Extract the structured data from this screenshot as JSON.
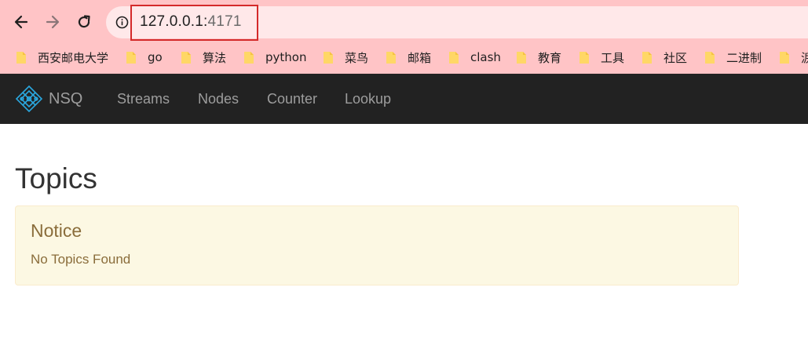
{
  "browser": {
    "address": {
      "host": "127.0.0.1:",
      "port": "4171"
    },
    "bookmarks": [
      {
        "label": "西安邮电大学",
        "icon": "folder-icon"
      },
      {
        "label": "go",
        "icon": "folder-icon"
      },
      {
        "label": "算法",
        "icon": "folder-icon"
      },
      {
        "label": "python",
        "icon": "folder-icon"
      },
      {
        "label": "菜鸟",
        "icon": "folder-icon"
      },
      {
        "label": "邮箱",
        "icon": "folder-icon"
      },
      {
        "label": "clash",
        "icon": "folder-icon"
      },
      {
        "label": "教育",
        "icon": "folder-icon"
      },
      {
        "label": "工具",
        "icon": "folder-icon"
      },
      {
        "label": "社区",
        "icon": "folder-icon"
      },
      {
        "label": "二进制",
        "icon": "folder-icon"
      },
      {
        "label": "涙",
        "icon": "folder-icon"
      }
    ],
    "colors": {
      "chrome": "#ffc4c6",
      "address_bg": "#ffe8e9",
      "highlight_border": "#d42a2a",
      "folder": "#ffd766"
    }
  },
  "navbar": {
    "brand": "NSQ",
    "links": [
      "Streams",
      "Nodes",
      "Counter",
      "Lookup"
    ],
    "colors": {
      "background": "#222222",
      "text": "#9d9d9d",
      "logo": "#2aa8e0"
    }
  },
  "main": {
    "title": "Topics",
    "notice": {
      "heading": "Notice",
      "text": "No Topics Found"
    },
    "colors": {
      "notice_bg": "#fcf8e3",
      "notice_border": "#faebcc",
      "notice_text": "#8a6d3b"
    }
  }
}
